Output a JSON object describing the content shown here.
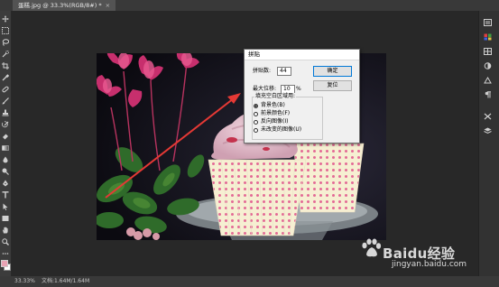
{
  "document": {
    "tab_title": "蛋糕.jpg @ 33.3%(RGB/8#) *",
    "tab_close": "×"
  },
  "statusbar": {
    "zoom": "33.33%",
    "doc_info": "文档:1.64M/1.64M"
  },
  "tools": [
    "move-tool",
    "marquee-tool",
    "lasso-tool",
    "quick-select-tool",
    "crop-tool",
    "eyedropper-tool",
    "healing-brush-tool",
    "brush-tool",
    "clone-stamp-tool",
    "history-brush-tool",
    "eraser-tool",
    "gradient-tool",
    "blur-tool",
    "dodge-tool",
    "pen-tool",
    "type-tool",
    "path-select-tool",
    "shape-tool",
    "hand-tool",
    "zoom-tool"
  ],
  "colors": {
    "foreground": "#e8a3b4",
    "background": "#ffffff",
    "arrow": "#e53935",
    "ui_dark": "#282828"
  },
  "dialog": {
    "title": "拼贴",
    "tiles_label": "拼贴数:",
    "tiles_value": "44",
    "max_offset_label": "最大位移:",
    "max_offset_value": "10",
    "percent_unit": "%",
    "fill_group_label": "填充空白区域用:",
    "options": [
      {
        "label": "背景色(B)",
        "selected": true
      },
      {
        "label": "前景颜色(F)",
        "selected": false
      },
      {
        "label": "反向图像(I)",
        "selected": false
      },
      {
        "label": "未改变的图像(U)",
        "selected": false
      }
    ],
    "ok_label": "确定",
    "reset_label": "复位"
  },
  "watermark": {
    "brand": "Baidu经验",
    "url": "jingyan.baidu.com"
  }
}
